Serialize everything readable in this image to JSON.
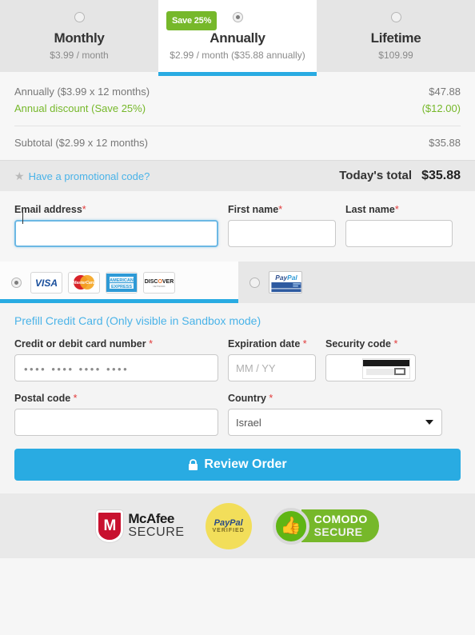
{
  "plans": [
    {
      "name": "Monthly",
      "price": "$3.99 / month",
      "selected": false,
      "badge": null
    },
    {
      "name": "Annually",
      "price": "$2.99 / month ($35.88 annually)",
      "selected": true,
      "badge": "Save 25%"
    },
    {
      "name": "Lifetime",
      "price": "$109.99",
      "selected": false,
      "badge": null
    }
  ],
  "summary": {
    "lines": [
      {
        "label": "Annually ($3.99 x 12 months)",
        "value": "$47.88",
        "style": "normal"
      },
      {
        "label": "Annual discount (Save 25%)",
        "value": "($12.00)",
        "style": "green"
      }
    ],
    "subtotal_label": "Subtotal ($2.99 x 12 months)",
    "subtotal_value": "$35.88",
    "promo_link": "Have a promotional code?",
    "total_label": "Today's total",
    "total_value": "$35.88"
  },
  "contact": {
    "email_label": "Email address",
    "email_value": "",
    "first_label": "First name",
    "first_value": "",
    "last_label": "Last name",
    "last_value": "",
    "required_mark": "*"
  },
  "payment": {
    "card_selected": true,
    "paypal_selected": false,
    "brands": [
      "VISA",
      "MasterCard",
      "American Express",
      "Discover"
    ],
    "paypal_label": "PayPal"
  },
  "card": {
    "prefill_link": "Prefill Credit Card (Only visible in Sandbox mode)",
    "number_label": "Credit or debit card number",
    "number_placeholder": "••••  ••••  ••••  ••••",
    "exp_label": "Expiration date",
    "exp_placeholder": "MM / YY",
    "cvv_label": "Security code",
    "cvv_value": "",
    "postal_label": "Postal code",
    "postal_value": "",
    "country_label": "Country",
    "country_value": "Israel",
    "country_options": [
      "Israel"
    ]
  },
  "submit": {
    "label": "Review Order",
    "icon": "lock-icon"
  },
  "trust": {
    "mcafee_line1": "McAfee",
    "mcafee_line2": "SECURE",
    "mcafee_mark": "M",
    "paypal_line1": "PayPal",
    "paypal_line2": "VERIFIED",
    "comodo_line1": "COMODO",
    "comodo_line2": "SECURE",
    "comodo_icon": "thumbs-up-icon"
  },
  "colors": {
    "accent_blue": "#29abe2",
    "link_blue": "#4ab3e8",
    "green": "#76b82a",
    "required_red": "#e23b3b"
  }
}
